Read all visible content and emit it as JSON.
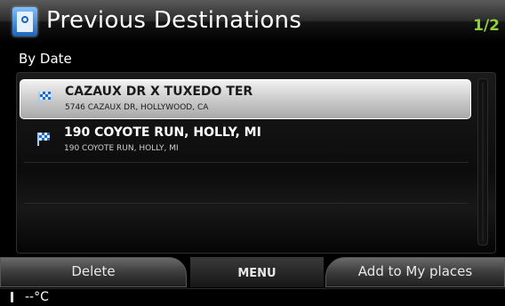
{
  "header": {
    "title": "Previous Destinations",
    "page_indicator": "1/2",
    "icon": "navigation-destination-icon"
  },
  "sort_label": "By Date",
  "destinations": [
    {
      "name": "CAZAUX DR X TUXEDO TER",
      "address": "5746 CAZAUX DR, HOLLYWOOD, CA",
      "icon": "checkered-flag-icon",
      "selected": true
    },
    {
      "name": "190 COYOTE RUN, HOLLY, MI",
      "address": "190 COYOTE RUN, HOLLY, MI",
      "icon": "checkered-flag-icon",
      "selected": false
    }
  ],
  "buttons": {
    "delete": "Delete",
    "menu": "MENU",
    "add_to_my_places": "Add to My places"
  },
  "status": {
    "temperature": "--°C",
    "indicator_icon": "thermometer-icon"
  }
}
